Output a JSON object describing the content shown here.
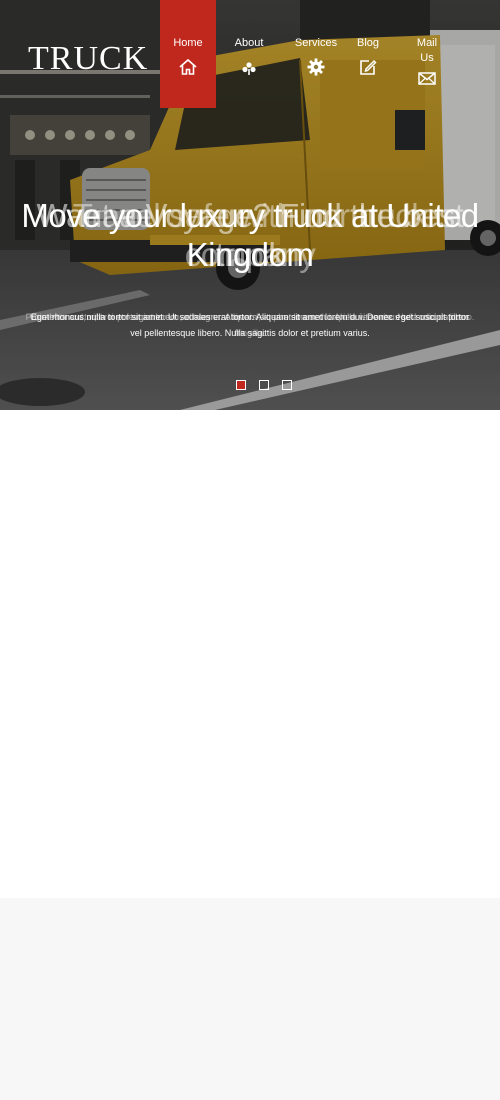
{
  "brand": {
    "logo_text": "TRUCK"
  },
  "nav": [
    {
      "label": "Home",
      "icon": "home-icon",
      "active": true
    },
    {
      "label": "About",
      "icon": "flower-icon",
      "active": false
    },
    {
      "label": "Services",
      "icon": "gear-icon",
      "active": false
    },
    {
      "label": "Blog",
      "icon": "edit-icon",
      "active": false
    },
    {
      "label": "Mail Us",
      "icon": "mail-icon",
      "active": false
    }
  ],
  "slider": {
    "slides": [
      {
        "title": "Move your luxury truck at United Kingdom",
        "description": "Eget rhoncus nulla tortor sit amet. Ut sodales erat tortor. Aliquam sit amet lorem dui. Donec eget suscipit tortor vel pellentesque libero. Nulla sagittis dolor et pretium varius."
      },
      {
        "title": "Want a Voyage? Find the best truck",
        "description": "Curabitur auctor, orci et feugiat lorem ac magna. Aliquam sit amet lorem dui. Nulla vitae risus sed odio dapibus fringilla."
      },
      {
        "title": "Travel safe with our truck company",
        "description": "Proin euismod, nibh in porta commodo, elit sem mattis nisl, at pharetra sem sapien nec ante. Nulla mauris libero."
      }
    ],
    "active_index": 0,
    "dot_count": 3
  },
  "colors": {
    "accent": "#c0271d",
    "truck_yellow": "#d8a925",
    "page_grey": "#f7f7f7"
  }
}
